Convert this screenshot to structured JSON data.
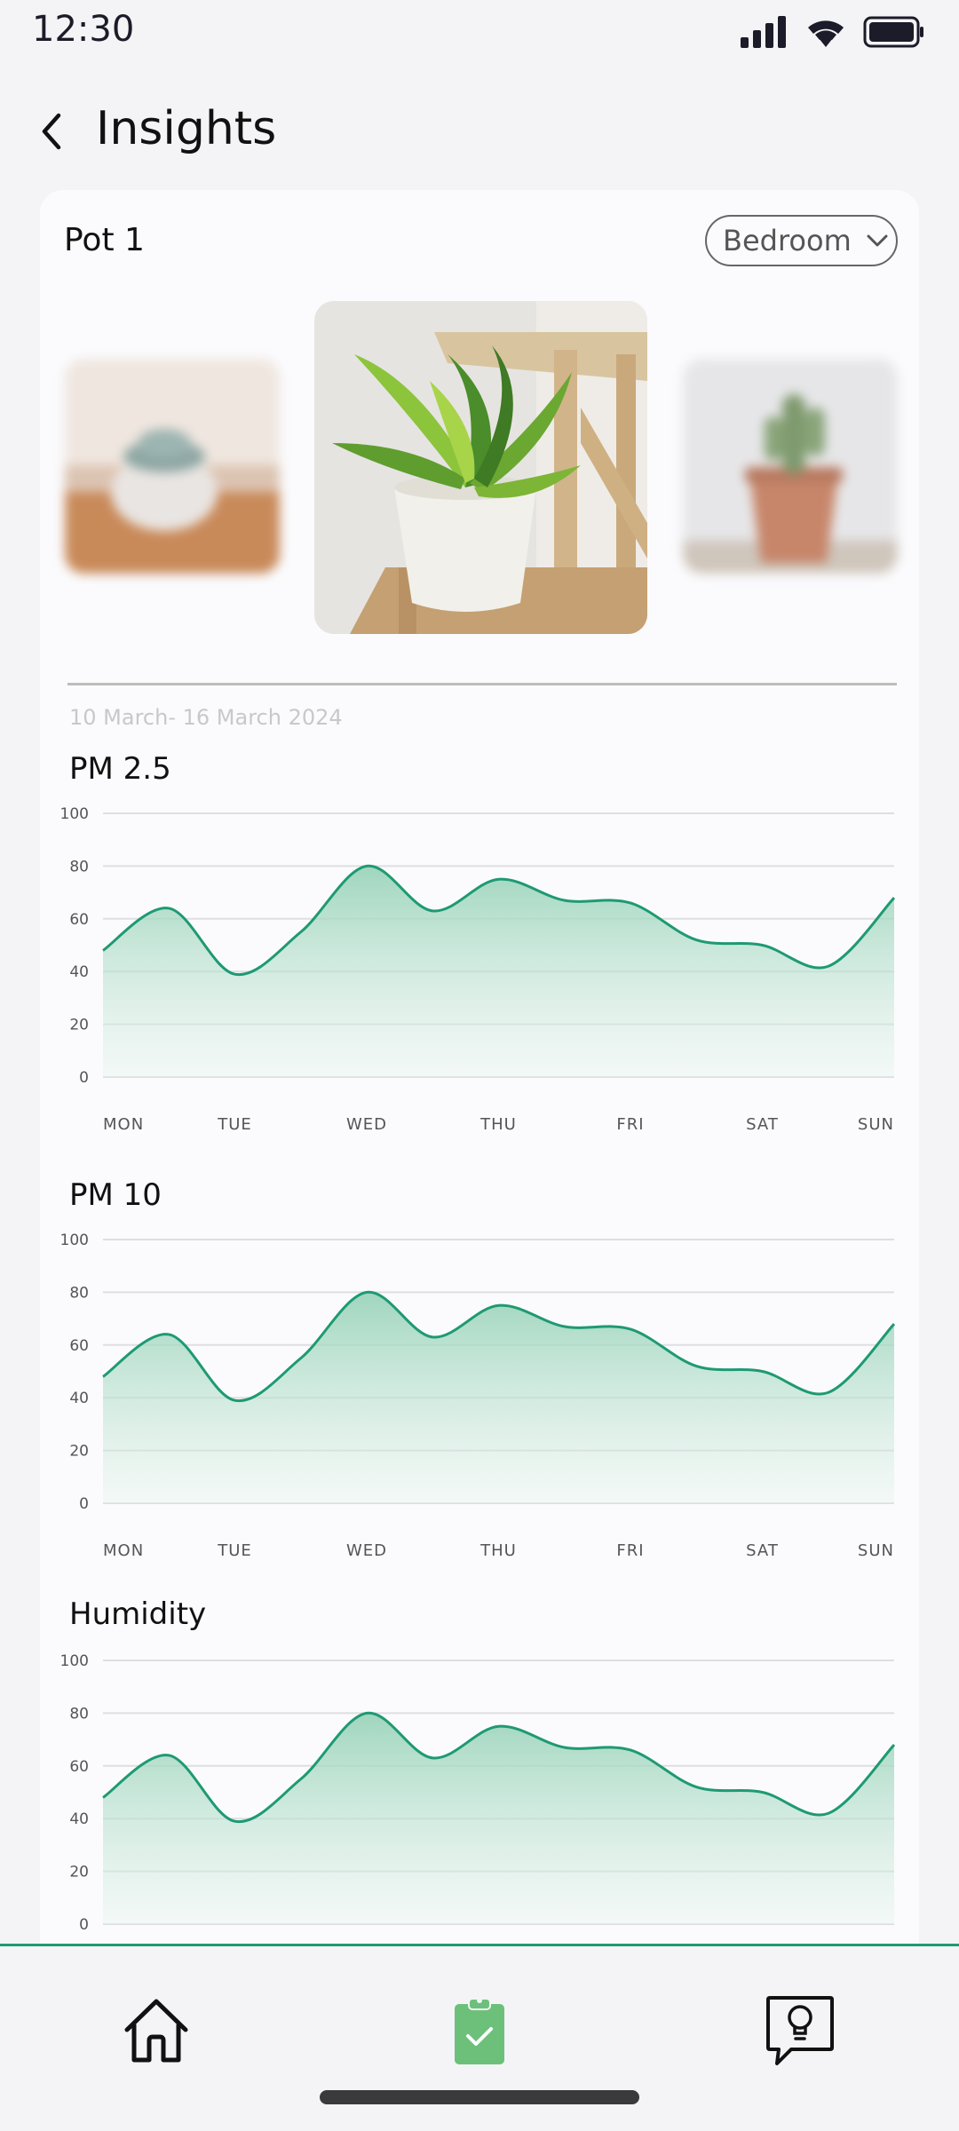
{
  "status_bar": {
    "time": "12:30"
  },
  "header": {
    "title": "Insights"
  },
  "pot": {
    "name": "Pot 1",
    "room": "Bedroom"
  },
  "date_range": "10 March- 16 March 2024",
  "charts": [
    {
      "title": "PM 2.5"
    },
    {
      "title": "PM 10"
    },
    {
      "title": "Humidity"
    }
  ],
  "chart_data": [
    {
      "type": "area",
      "title": "PM 2.5",
      "categories": [
        "MON",
        "TUE",
        "WED",
        "THU",
        "FRI",
        "SAT",
        "SUN"
      ],
      "x": [
        0,
        0.5,
        1,
        1.5,
        2,
        2.5,
        3,
        3.5,
        4,
        4.5,
        5,
        5.5,
        6
      ],
      "values": [
        48,
        64,
        39,
        55,
        80,
        63,
        75,
        67,
        66,
        52,
        50,
        42,
        68
      ],
      "ylim": [
        0,
        100
      ],
      "yticks": [
        0,
        20,
        40,
        60,
        80,
        100
      ],
      "grid": true,
      "color": "#1e9a72"
    },
    {
      "type": "area",
      "title": "PM 10",
      "categories": [
        "MON",
        "TUE",
        "WED",
        "THU",
        "FRI",
        "SAT",
        "SUN"
      ],
      "x": [
        0,
        0.5,
        1,
        1.5,
        2,
        2.5,
        3,
        3.5,
        4,
        4.5,
        5,
        5.5,
        6
      ],
      "values": [
        48,
        64,
        39,
        55,
        80,
        63,
        75,
        67,
        66,
        52,
        50,
        42,
        68
      ],
      "ylim": [
        0,
        100
      ],
      "yticks": [
        0,
        20,
        40,
        60,
        80,
        100
      ],
      "grid": true,
      "color": "#1e9a72"
    },
    {
      "type": "area",
      "title": "Humidity",
      "categories": [
        "MON",
        "TUE",
        "WED",
        "THU",
        "FRI",
        "SAT",
        "SUN"
      ],
      "x": [
        0,
        0.5,
        1,
        1.5,
        2,
        2.5,
        3,
        3.5,
        4,
        4.5,
        5,
        5.5,
        6
      ],
      "values": [
        48,
        64,
        39,
        55,
        80,
        63,
        75,
        67,
        66,
        52,
        50,
        42,
        68
      ],
      "ylim": [
        0,
        100
      ],
      "yticks": [
        0,
        20,
        40,
        60,
        80,
        100
      ],
      "grid": true,
      "color": "#1e9a72"
    }
  ],
  "nav": {
    "items": [
      {
        "icon": "home-icon"
      },
      {
        "icon": "clipboard-check-icon",
        "active": true
      },
      {
        "icon": "tips-lightbulb-icon"
      }
    ]
  },
  "colors": {
    "accent": "#1e9a72",
    "active_nav": "#6cc07a",
    "card_bg": "#fbfbfd",
    "page_bg": "#f4f4f6"
  }
}
